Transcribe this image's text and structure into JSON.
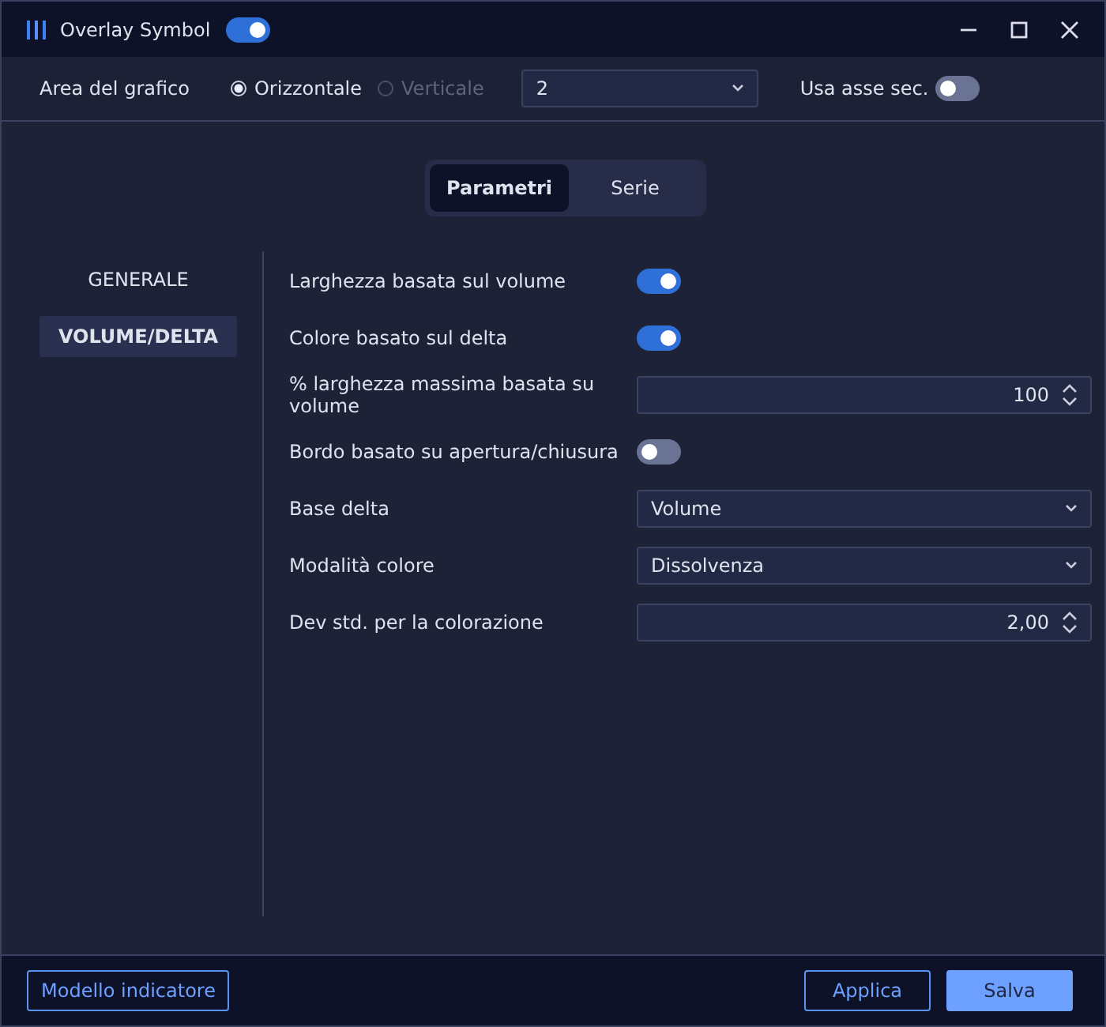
{
  "window": {
    "title": "Overlay Symbol",
    "enabled": true
  },
  "toolbar": {
    "label": "Area del grafico",
    "orientation": [
      {
        "label": "Orizzontale",
        "selected": true,
        "disabled": false
      },
      {
        "label": "Verticale",
        "selected": false,
        "disabled": true
      }
    ],
    "pane": "2",
    "secondary_axis": {
      "label": "Usa asse sec.",
      "on": false
    }
  },
  "tabs": [
    {
      "label": "Parametri",
      "selected": true
    },
    {
      "label": "Serie",
      "selected": false
    }
  ],
  "sidebar": {
    "items": [
      {
        "label": "GENERALE",
        "selected": false
      },
      {
        "label": "VOLUME/DELTA",
        "selected": true
      }
    ]
  },
  "settings": [
    {
      "kind": "toggle",
      "label": "Larghezza basata sul volume",
      "on": true
    },
    {
      "kind": "toggle",
      "label": "Colore basato sul delta",
      "on": true
    },
    {
      "kind": "number",
      "label": "% larghezza massima basata su volume",
      "value": "100"
    },
    {
      "kind": "toggle",
      "label": "Bordo basato su apertura/chiusura",
      "on": false
    },
    {
      "kind": "select",
      "label": "Base delta",
      "value": "Volume"
    },
    {
      "kind": "select",
      "label": "Modalità colore",
      "value": "Dissolvenza"
    },
    {
      "kind": "number",
      "label": "Dev std. per la colorazione",
      "value": "2,00"
    }
  ],
  "footer": {
    "template_button": "Modello indicatore",
    "buttons": [
      "Applica",
      "Salva"
    ]
  }
}
